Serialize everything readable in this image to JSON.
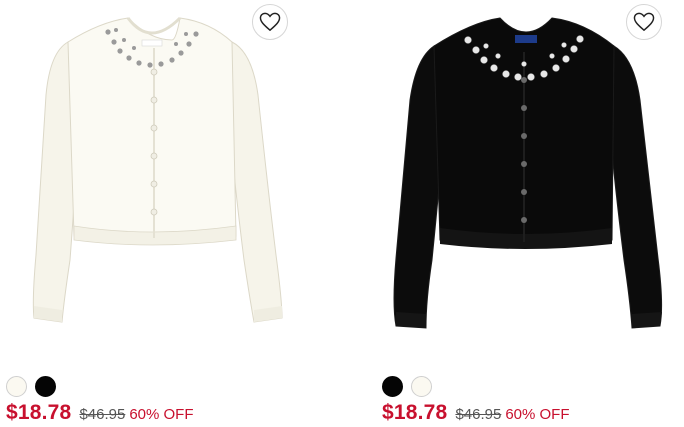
{
  "products": [
    {
      "image_alt": "Ivory jeweled neckline cardigan",
      "favorite_icon": "heart-outline-icon",
      "swatches": [
        {
          "color_name": "ivory",
          "hex": "#fbf9f1"
        },
        {
          "color_name": "black",
          "hex": "#050505"
        }
      ],
      "sale_price": "$18.78",
      "original_price": "$46.95",
      "discount": "60% OFF"
    },
    {
      "image_alt": "Black jeweled neckline cardigan",
      "favorite_icon": "heart-outline-icon",
      "swatches": [
        {
          "color_name": "black",
          "hex": "#050505"
        },
        {
          "color_name": "ivory",
          "hex": "#fbf9f1"
        }
      ],
      "sale_price": "$18.78",
      "original_price": "$46.95",
      "discount": "60% OFF"
    }
  ],
  "colors": {
    "sale_red": "#c8102e",
    "strike_gray": "#555555"
  }
}
